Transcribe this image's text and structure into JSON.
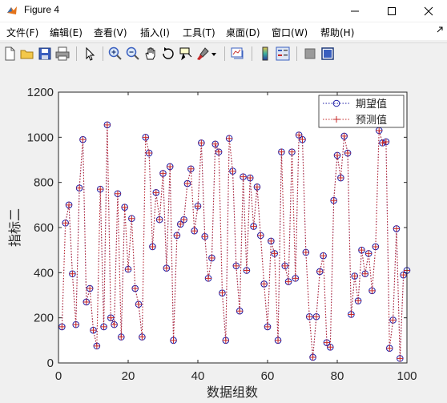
{
  "window": {
    "title": "Figure 4"
  },
  "menu": [
    "文件(F)",
    "编辑(E)",
    "查看(V)",
    "插入(I)",
    "工具(T)",
    "桌面(D)",
    "窗口(W)",
    "帮助(H)"
  ],
  "toolbar": [
    "new-figure-icon",
    "open-file-icon",
    "save-icon",
    "print-icon",
    "pointer-icon",
    "zoom-in-icon",
    "zoom-out-icon",
    "pan-icon",
    "rotate-3d-icon",
    "data-cursor-icon",
    "brush-icon",
    "link-plot-icon",
    "colorbar-icon",
    "legend-icon",
    "hide-plot-tools-icon",
    "show-plot-tools-icon"
  ],
  "chart_data": {
    "type": "line",
    "xlabel": "数据组数",
    "ylabel": "指标二",
    "xlim": [
      0,
      100
    ],
    "ylim": [
      0,
      1200
    ],
    "xticks": [
      0,
      20,
      40,
      60,
      80,
      100
    ],
    "yticks": [
      0,
      200,
      400,
      600,
      800,
      1000,
      1200
    ],
    "legend_position": "top-right",
    "x": [
      1,
      2,
      3,
      4,
      5,
      6,
      7,
      8,
      9,
      10,
      11,
      12,
      13,
      14,
      15,
      16,
      17,
      18,
      19,
      20,
      21,
      22,
      23,
      24,
      25,
      26,
      27,
      28,
      29,
      30,
      31,
      32,
      33,
      34,
      35,
      36,
      37,
      38,
      39,
      40,
      41,
      42,
      43,
      44,
      45,
      46,
      47,
      48,
      49,
      50,
      51,
      52,
      53,
      54,
      55,
      56,
      57,
      58,
      59,
      60,
      61,
      62,
      63,
      64,
      65,
      66,
      67,
      68,
      69,
      70,
      71,
      72,
      73,
      74,
      75,
      76,
      77,
      78,
      79,
      80,
      81,
      82,
      83,
      84,
      85,
      86,
      87,
      88,
      89,
      90,
      91,
      92,
      93,
      94,
      95,
      96,
      97,
      98,
      99,
      100
    ],
    "series": [
      {
        "name": "期望值",
        "color": "#1a1aa6",
        "marker": "circle",
        "values": [
          160,
          620,
          700,
          395,
          170,
          775,
          990,
          270,
          330,
          145,
          75,
          770,
          160,
          1055,
          200,
          170,
          750,
          115,
          690,
          415,
          640,
          330,
          260,
          115,
          1000,
          930,
          515,
          755,
          635,
          840,
          420,
          870,
          100,
          565,
          615,
          635,
          795,
          860,
          585,
          695,
          975,
          560,
          375,
          465,
          970,
          935,
          310,
          100,
          995,
          850,
          430,
          230,
          825,
          410,
          820,
          605,
          780,
          565,
          350,
          160,
          540,
          485,
          100,
          935,
          430,
          360,
          935,
          375,
          1010,
          990,
          490,
          205,
          25,
          205,
          405,
          475,
          90,
          70,
          720,
          920,
          820,
          1005,
          930,
          215,
          385,
          275,
          500,
          395,
          485,
          320,
          515,
          1030,
          975,
          980,
          65,
          190,
          595,
          20,
          390,
          410
        ]
      },
      {
        "name": "预测值",
        "color": "#c62828",
        "marker": "plus",
        "values": [
          160,
          620,
          700,
          395,
          170,
          775,
          990,
          270,
          330,
          145,
          75,
          770,
          160,
          1055,
          200,
          170,
          750,
          115,
          690,
          415,
          640,
          330,
          260,
          115,
          1000,
          930,
          515,
          755,
          635,
          840,
          420,
          870,
          100,
          565,
          615,
          635,
          795,
          860,
          585,
          695,
          975,
          560,
          375,
          465,
          970,
          935,
          310,
          100,
          995,
          850,
          430,
          230,
          825,
          410,
          820,
          605,
          780,
          565,
          350,
          160,
          540,
          485,
          100,
          935,
          430,
          360,
          935,
          375,
          1010,
          990,
          490,
          205,
          25,
          205,
          405,
          475,
          90,
          70,
          720,
          920,
          820,
          1005,
          930,
          215,
          385,
          275,
          500,
          395,
          485,
          320,
          515,
          1030,
          975,
          980,
          65,
          190,
          595,
          20,
          390,
          410
        ]
      }
    ]
  }
}
